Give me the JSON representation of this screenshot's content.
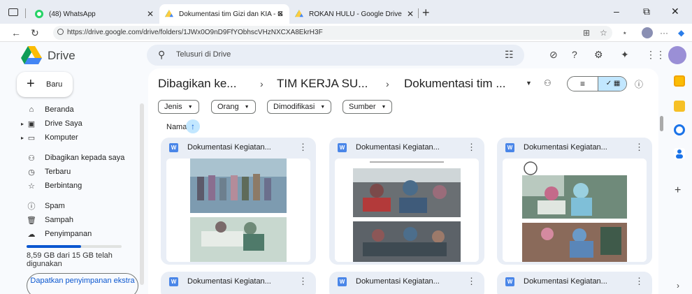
{
  "browser": {
    "tabs": [
      {
        "label": "(48) WhatsApp"
      },
      {
        "label": "Dokumentasi tim Gizi dan KIA - G"
      },
      {
        "label": "ROKAN HULU - Google Drive"
      }
    ],
    "url": "https://drive.google.com/drive/folders/1JWx0O9nD9FfYObhscVHzNXCXA8EkrH3F"
  },
  "app": {
    "name": "Drive",
    "search_placeholder": "Telusuri di Drive"
  },
  "sidebar": {
    "new_label": "Baru",
    "items": [
      {
        "label": "Beranda",
        "icon": "home-icon"
      },
      {
        "label": "Drive Saya",
        "icon": "my-drive-icon"
      },
      {
        "label": "Komputer",
        "icon": "computer-icon"
      },
      {
        "label": "Dibagikan kepada saya",
        "icon": "shared-icon"
      },
      {
        "label": "Terbaru",
        "icon": "clock-icon"
      },
      {
        "label": "Berbintang",
        "icon": "star-icon"
      },
      {
        "label": "Spam",
        "icon": "spam-icon"
      },
      {
        "label": "Sampah",
        "icon": "trash-icon"
      },
      {
        "label": "Penyimpanan",
        "icon": "cloud-icon"
      }
    ],
    "storage_fraction": 0.57,
    "storage_text": "8,59 GB dari 15 GB telah digunakan",
    "get_more_label": "Dapatkan penyimpanan ekstra"
  },
  "breadcrumb": [
    "Dibagikan ke...",
    "TIM KERJA SU...",
    "Dokumentasi tim ..."
  ],
  "filters": [
    "Jenis",
    "Orang",
    "Dimodifikasi",
    "Sumber"
  ],
  "sort": {
    "label": "Nama"
  },
  "files": [
    {
      "title": "Dokumentasi Kegiatan..."
    },
    {
      "title": "Dokumentasi Kegiatan..."
    },
    {
      "title": "Dokumentasi Kegiatan..."
    },
    {
      "title": "Dokumentasi Kegiatan..."
    },
    {
      "title": "Dokumentasi Kegiatan..."
    },
    {
      "title": "Dokumentasi Kegiatan..."
    }
  ],
  "colors": {
    "accent": "#0b57d0",
    "selected": "#c2e7ff",
    "card": "#e9eef6"
  }
}
